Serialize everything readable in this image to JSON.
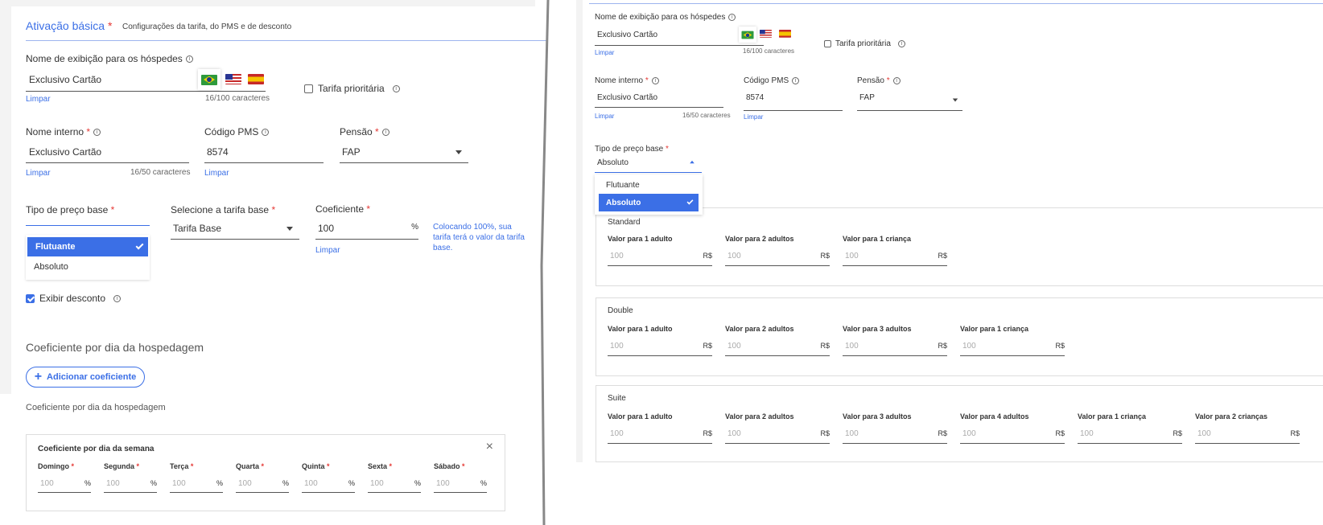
{
  "left": {
    "section_title": "Ativação básica",
    "section_subtitle": "Configurações da tarifa, do PMS e de desconto",
    "display_name_label": "Nome de exibição para os hóspedes",
    "display_name_value": "Exclusivo Cartão",
    "display_name_clear": "Limpar",
    "display_name_count": "16/100 caracteres",
    "priority_label": "Tarifa prioritária",
    "internal_label": "Nome interno",
    "internal_value": "Exclusivo Cartão",
    "internal_clear": "Limpar",
    "internal_count": "16/50 caracteres",
    "pms_label": "Código PMS",
    "pms_value": "8574",
    "pms_clear": "Limpar",
    "pension_label": "Pensão",
    "pension_value": "FAP",
    "base_type_label": "Tipo de preço base",
    "base_type_options": [
      "Flutuante",
      "Absoluto"
    ],
    "base_rate_label": "Selecione a tarifa base",
    "base_rate_value": "Tarifa Base",
    "coef_label": "Coeficiente",
    "coef_value": "100",
    "coef_unit": "%",
    "coef_clear": "Limpar",
    "coef_hint": "Colocando 100%, sua tarifa terá o valor da tarifa base.",
    "show_discount_label": "Exibir desconto",
    "day_coef_title": "Coeficiente por dia da hospedagem",
    "add_coef_button": "Adicionar coeficiente",
    "day_coef_caption": "Coeficiente por dia da hospedagem",
    "week_card_title": "Coeficiente por dia da semana",
    "week_days": [
      {
        "name": "Domingo",
        "value": "100"
      },
      {
        "name": "Segunda",
        "value": "100"
      },
      {
        "name": "Terça",
        "value": "100"
      },
      {
        "name": "Quarta",
        "value": "100"
      },
      {
        "name": "Quinta",
        "value": "100"
      },
      {
        "name": "Sexta",
        "value": "100"
      },
      {
        "name": "Sábado",
        "value": "100"
      }
    ],
    "percent": "%"
  },
  "right": {
    "display_name_label": "Nome de exibição para os hóspedes",
    "display_name_value": "Exclusivo Cartão",
    "display_name_clear": "Limpar",
    "display_name_count": "16/100 caracteres",
    "priority_label": "Tarifa prioritária",
    "internal_label": "Nome interno",
    "internal_value": "Exclusivo Cartão",
    "internal_clear": "Limpar",
    "internal_count": "16/50 caracteres",
    "pms_label": "Código PMS",
    "pms_value": "8574",
    "pms_clear": "Limpar",
    "pension_label": "Pensão",
    "pension_value": "FAP",
    "base_type_label": "Tipo de preço base",
    "base_type_value": "Absoluto",
    "base_type_options": [
      "Flutuante",
      "Absoluto"
    ],
    "currency": "R$",
    "rooms": [
      {
        "name": "Standard",
        "fields": [
          {
            "label": "Valor para 1 adulto",
            "value": "100"
          },
          {
            "label": "Valor para 2 adultos",
            "value": "100"
          },
          {
            "label": "Valor para 1 criança",
            "value": "100"
          }
        ]
      },
      {
        "name": "Double",
        "fields": [
          {
            "label": "Valor para 1 adulto",
            "value": "100"
          },
          {
            "label": "Valor para 2 adultos",
            "value": "100"
          },
          {
            "label": "Valor para 3 adultos",
            "value": "100"
          },
          {
            "label": "Valor para 1 criança",
            "value": "100"
          }
        ]
      },
      {
        "name": "Suite",
        "fields": [
          {
            "label": "Valor para 1 adulto",
            "value": "100"
          },
          {
            "label": "Valor para 2 adultos",
            "value": "100"
          },
          {
            "label": "Valor para 3 adultos",
            "value": "100"
          },
          {
            "label": "Valor para 4 adultos",
            "value": "100"
          },
          {
            "label": "Valor para 1 criança",
            "value": "100"
          },
          {
            "label": "Valor para 2 crianças",
            "value": "100"
          }
        ]
      }
    ]
  }
}
